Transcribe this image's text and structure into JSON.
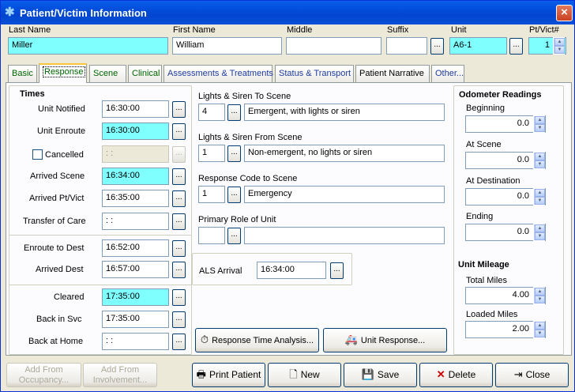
{
  "window": {
    "title": "Patient/Victim Information",
    "close": "×"
  },
  "header": {
    "last_name_label": "Last Name",
    "last_name": "Miller",
    "first_name_label": "First Name",
    "first_name": "William",
    "middle_label": "Middle",
    "middle": "",
    "suffix_label": "Suffix",
    "suffix": "",
    "unit_label": "Unit",
    "unit": "A6-1",
    "ptvict_label": "Pt/Vict#",
    "ptvict": "1"
  },
  "tabs": [
    "Basic",
    "Response",
    "Scene",
    "Clinical",
    "Assessments & Treatments",
    "Status & Transport",
    "Patient Narrative",
    "Other..."
  ],
  "times": {
    "heading": "Times",
    "unit_notified_label": "Unit Notified",
    "unit_notified": "16:30:00",
    "unit_enroute_label": "Unit Enroute",
    "unit_enroute": "16:30:00",
    "cancelled_label": "Cancelled",
    "cancelled": " :  :",
    "arrived_scene_label": "Arrived Scene",
    "arrived_scene": "16:34:00",
    "arrived_pt_label": "Arrived Pt/Vict",
    "arrived_pt": "16:35:00",
    "transfer_label": "Transfer of Care",
    "transfer": " :  :",
    "enroute_dest_label": "Enroute to Dest",
    "enroute_dest": "16:52:00",
    "arrived_dest_label": "Arrived Dest",
    "arrived_dest": "16:57:00",
    "cleared_label": "Cleared",
    "cleared": "17:35:00",
    "back_svc_label": "Back in Svc",
    "back_svc": "17:35:00",
    "back_home_label": "Back at Home",
    "back_home": " :  :"
  },
  "response": {
    "ls_to_label": "Lights & Siren To Scene",
    "ls_to_code": "4",
    "ls_to_desc": "Emergent, with lights or siren",
    "ls_from_label": "Lights & Siren From Scene",
    "ls_from_code": "1",
    "ls_from_desc": "Non-emergent, no lights or siren",
    "resp_code_label": "Response Code to Scene",
    "resp_code": "1",
    "resp_desc": "Emergency",
    "role_label": "Primary Role of Unit",
    "role_code": "",
    "role_desc": "",
    "als_label": "ALS Arrival",
    "als": "16:34:00"
  },
  "odometer": {
    "heading": "Odometer Readings",
    "beginning_label": "Beginning",
    "beginning": "0.0",
    "at_scene_label": "At Scene",
    "at_scene": "0.0",
    "at_dest_label": "At Destination",
    "at_dest": "0.0",
    "ending_label": "Ending",
    "ending": "0.0"
  },
  "mileage": {
    "heading": "Unit Mileage",
    "total_label": "Total Miles",
    "total": "4.00",
    "loaded_label": "Loaded Miles",
    "loaded": "2.00"
  },
  "buttons": {
    "rta": "Response Time Analysis...",
    "unit_response": "Unit Response...",
    "add_occ_1": "Add From",
    "add_occ_2": "Occupancy...",
    "add_inv_1": "Add From",
    "add_inv_2": "Involvement...",
    "print": "Print Patient",
    "new": "New",
    "save": "Save",
    "delete": "Delete",
    "close": "Close",
    "ellipsis": "..."
  },
  "colors": {
    "highlight": "#80FFFF",
    "title_bar": "#0454E3",
    "tab_green": "#006400",
    "tab_blue": "#1F3BA0"
  }
}
